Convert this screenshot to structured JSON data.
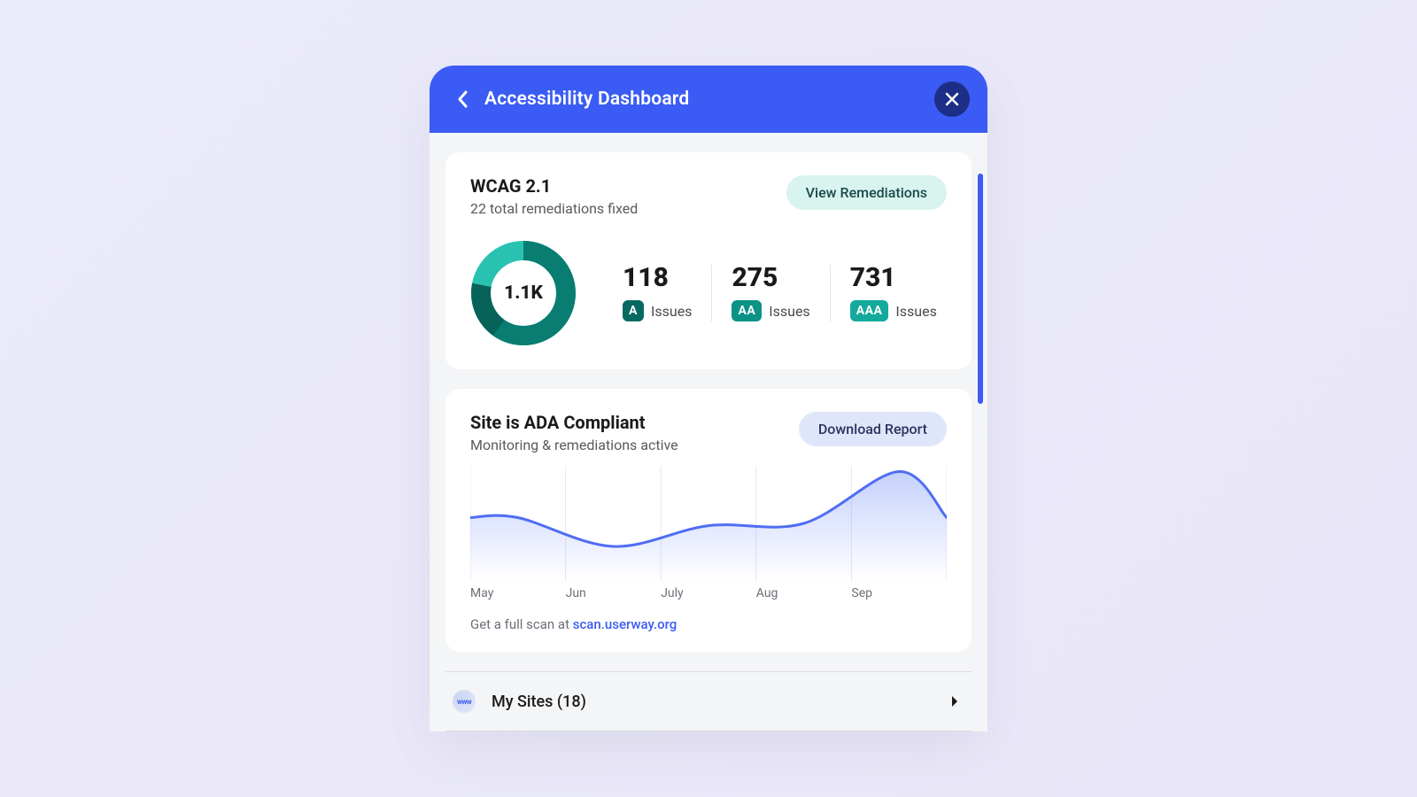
{
  "header": {
    "title": "Accessibility Dashboard"
  },
  "wcag": {
    "title": "WCAG 2.1",
    "subtitle": "22 total remediations fixed",
    "button": "View Remediations",
    "donut_center": "1.1K",
    "issues": [
      {
        "value": "118",
        "level": "A",
        "label": "Issues"
      },
      {
        "value": "275",
        "level": "AA",
        "label": "Issues"
      },
      {
        "value": "731",
        "level": "AAA",
        "label": "Issues"
      }
    ]
  },
  "compliance": {
    "title": "Site is ADA Compliant",
    "subtitle": "Monitoring & remediations active",
    "button": "Download Report",
    "scan_prefix": "Get a full scan at ",
    "scan_link": "scan.userway.org"
  },
  "chart_data": {
    "type": "line",
    "categories": [
      "May",
      "Jun",
      "July",
      "Aug",
      "Sep"
    ],
    "values": [
      55,
      30,
      48,
      50,
      95
    ],
    "title": "",
    "xlabel": "",
    "ylabel": "",
    "ylim": [
      0,
      100
    ]
  },
  "mysites": {
    "icon_text": "www",
    "label": "My Sites (18)"
  }
}
